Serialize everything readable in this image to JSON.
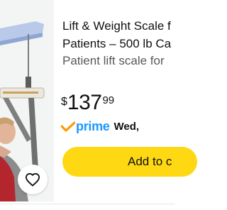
{
  "product": {
    "title_line1": "Lift & Weight Scale f",
    "title_line2": "Patients – 500 lb Ca",
    "subtitle": "Patient lift scale for",
    "image_icon": "patient-lift-scale-photo",
    "wishlist_icon": "heart-outline-icon"
  },
  "price": {
    "symbol": "$",
    "whole": "137",
    "fraction": "99"
  },
  "shipping": {
    "prime_label": "prime",
    "prime_icon": "prime-check-icon",
    "delivery_text": "Wed,"
  },
  "actions": {
    "add_to_cart_label": "Add to c"
  },
  "colors": {
    "button_yellow": "#ffd814",
    "prime_blue": "#1a98ff",
    "prime_check_orange": "#ff9900",
    "text_dark": "#0f1111",
    "text_gray": "#565959"
  }
}
